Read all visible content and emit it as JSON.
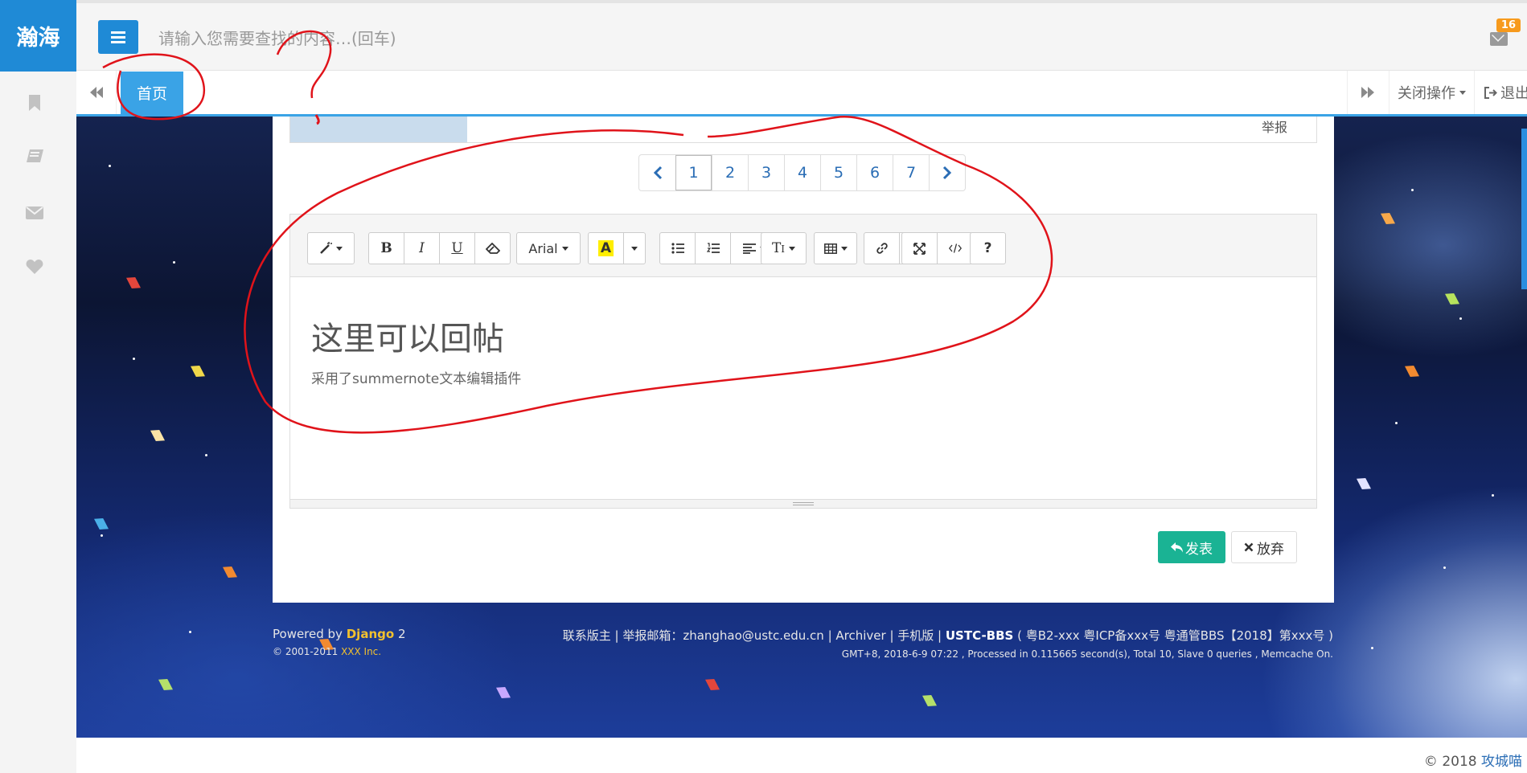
{
  "app": {
    "logo": "瀚海"
  },
  "header": {
    "search_placeholder": "请输入您需要查找的内容…(回车)",
    "mail_count": "16"
  },
  "tabs": {
    "home": "首页",
    "close_ops": "关闭操作",
    "logout": "退出"
  },
  "thread": {
    "prev_row_label": "举报"
  },
  "pagination": {
    "pages": [
      "1",
      "2",
      "3",
      "4",
      "5",
      "6",
      "7"
    ],
    "current": "1"
  },
  "editor": {
    "font_name": "Arial",
    "highlight_letter": "A",
    "heading": "这里可以回帖",
    "body": "采用了summernote文本编辑插件",
    "help": "?"
  },
  "actions": {
    "post": "发表",
    "discard": "放弃"
  },
  "footer": {
    "powered_prefix": "Powered by",
    "powered_name": "Django",
    "powered_version": "2",
    "copyright_prefix": "© 2001-2011",
    "copyright_company": "XXX Inc.",
    "links": "联系版主 | 举报邮箱：zhanghao@ustc.edu.cn | Archiver | 手机版 |",
    "site_name": "USTC-BBS",
    "license": "( 粤B2-xxx 粤ICP备xxx号 粤通管BBS【2018】第xxx号 )",
    "stats": "GMT+8, 2018-6-9 07:22 , Processed in 0.115665 second(s), Total 10, Slave 0 queries , Memcache On."
  },
  "corner": {
    "year": "© 2018",
    "author": "攻城喵"
  },
  "colors": {
    "brand": "#1f8ad6",
    "tab_active": "#3aa3e6",
    "post_button": "#1ab394",
    "annotation": "#e0131a"
  }
}
